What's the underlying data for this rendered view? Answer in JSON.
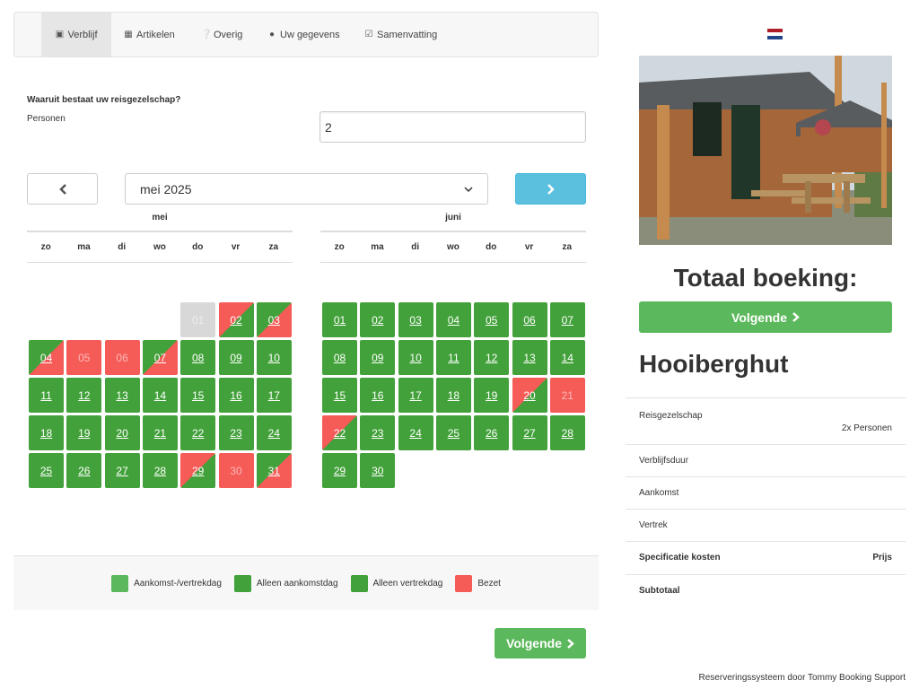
{
  "steps": [
    {
      "label": "Verblijf",
      "icon": "bus-icon",
      "active": true
    },
    {
      "label": "Artikelen",
      "icon": "grid-icon"
    },
    {
      "label": "Overig",
      "icon": "question-circle-icon"
    },
    {
      "label": "Uw gegevens",
      "icon": "user-icon"
    },
    {
      "label": "Samenvatting",
      "icon": "check-square-icon"
    }
  ],
  "party": {
    "question": "Waaruit bestaat uw reisgezelschap?",
    "persons_label": "Personen",
    "persons_value": "2"
  },
  "calendar": {
    "selected_month": "mei 2025",
    "weekdays": [
      "zo",
      "ma",
      "di",
      "wo",
      "do",
      "vr",
      "za"
    ],
    "months": [
      {
        "name": "mei",
        "days": [
          "01",
          "02",
          "03",
          "04",
          "05",
          "06",
          "07",
          "08",
          "09",
          "10",
          "11",
          "12",
          "13",
          "14",
          "15",
          "16",
          "17",
          "18",
          "19",
          "20",
          "21",
          "22",
          "23",
          "24",
          "25",
          "26",
          "27",
          "28",
          "29",
          "30",
          "31"
        ]
      },
      {
        "name": "juni",
        "days": [
          "01",
          "02",
          "03",
          "04",
          "05",
          "06",
          "07",
          "08",
          "09",
          "10",
          "11",
          "12",
          "13",
          "14",
          "15",
          "16",
          "17",
          "18",
          "19",
          "20",
          "21",
          "22",
          "23",
          "24",
          "25",
          "26",
          "27",
          "28",
          "29",
          "30"
        ]
      }
    ]
  },
  "legend": [
    {
      "label": "Aankomst-/vertrekdag",
      "color": "#5cb85c"
    },
    {
      "label": "Alleen aankomstdag",
      "color": "#42a13a"
    },
    {
      "label": "Alleen vertrekdag",
      "color": "#42a13a"
    },
    {
      "label": "Bezet",
      "color": "#f55b57"
    }
  ],
  "buttons": {
    "next": "Volgende"
  },
  "sidebar": {
    "total_title": "Totaal boeking:",
    "next_label": "Volgende",
    "accommodation": "Hooiberghut",
    "rows": {
      "party_label": "Reisgezelschap",
      "party_value": "2x Personen",
      "duration_label": "Verblijfsduur",
      "arrival_label": "Aankomst",
      "departure_label": "Vertrek",
      "costs_label": "Specificatie kosten",
      "price_label": "Prijs",
      "subtotal_label": "Subtotaal"
    }
  },
  "footer": "Reserveringssysteem door Tommy Booking Support",
  "colors": {
    "available": "#42a13a",
    "booked": "#f55b57",
    "next_button": "#5bc0de",
    "primary": "#5cb85c"
  }
}
